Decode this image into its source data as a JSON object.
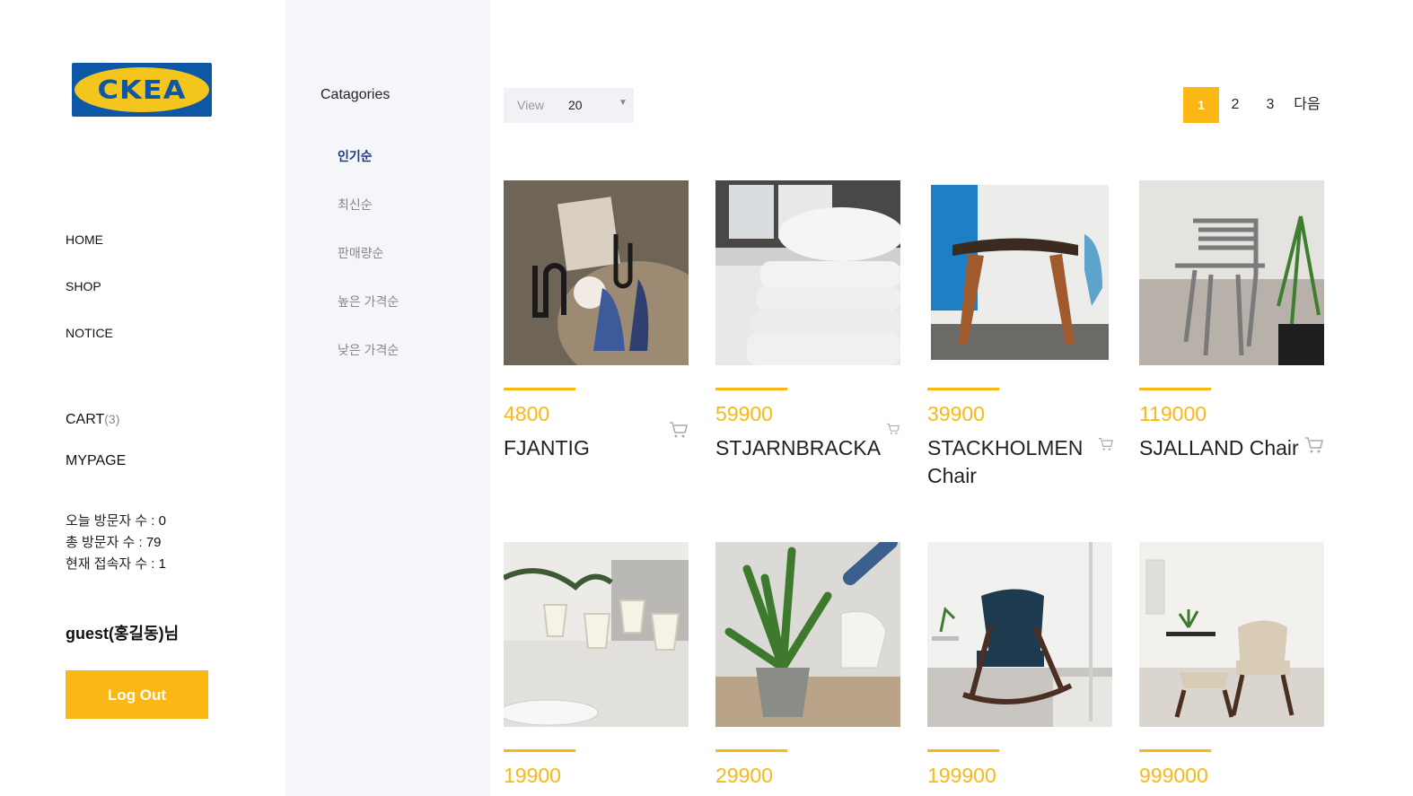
{
  "brand": {
    "logo_text": "CKEA",
    "colors": {
      "blue": "#0c58a6",
      "yellow": "#f4c51c",
      "accent": "#fbb714"
    }
  },
  "nav": {
    "items": [
      {
        "label": "HOME"
      },
      {
        "label": "SHOP"
      },
      {
        "label": "NOTICE"
      }
    ]
  },
  "cart": {
    "label": "CART",
    "count": "(3)"
  },
  "mypage": {
    "label": "MYPAGE"
  },
  "stats": {
    "today_label": "오늘 방문자 수 : ",
    "today_value": "0",
    "total_label": "총 방문자 수 : ",
    "total_value": "79",
    "current_label": "현재 접속자 수 : ",
    "current_value": "1"
  },
  "user": {
    "greeting": "guest(홍길동)님"
  },
  "logout": {
    "label": "Log Out"
  },
  "categories": {
    "title": "Catagories",
    "items": [
      {
        "label": "인기순",
        "active": true
      },
      {
        "label": "최신순"
      },
      {
        "label": "판매량순"
      },
      {
        "label": "높은 가격순"
      },
      {
        "label": "낮은 가격순"
      }
    ]
  },
  "view": {
    "label": "View",
    "value": "20"
  },
  "pagination": {
    "pages": [
      "1",
      "2",
      "3"
    ],
    "current": "1",
    "next": "다음"
  },
  "products": [
    {
      "price": "4800",
      "name": "FJANTIG",
      "icon": "cart-icon"
    },
    {
      "price": "59900",
      "name": "STJARNBRACKA",
      "icon": "cart-icon"
    },
    {
      "price": "39900",
      "name": "STACKHOLMEN Chair",
      "icon": "cart-icon"
    },
    {
      "price": "119000",
      "name": "SJALLAND Chair",
      "icon": "cart-icon"
    },
    {
      "price": "19900",
      "name": "",
      "icon": ""
    },
    {
      "price": "29900",
      "name": "",
      "icon": ""
    },
    {
      "price": "199900",
      "name": "",
      "icon": ""
    },
    {
      "price": "999000",
      "name": "",
      "icon": ""
    }
  ]
}
